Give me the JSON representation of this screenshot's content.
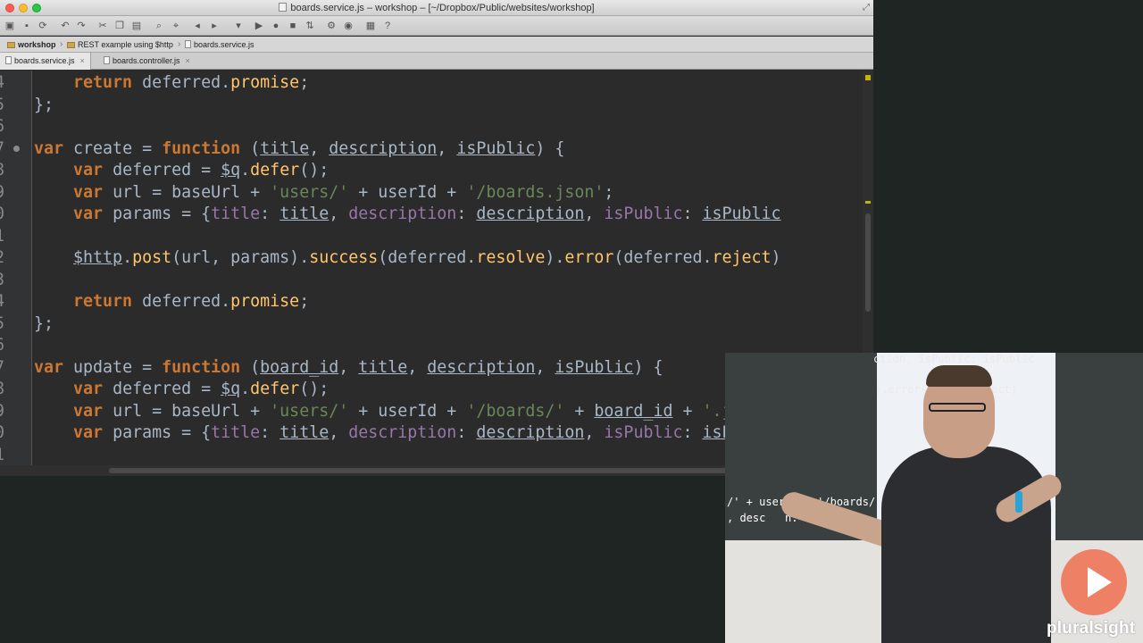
{
  "window": {
    "title": "boards.service.js – workshop – [~/Dropbox/Public/websites/workshop]"
  },
  "navbar": {
    "crumbs": [
      "workshop",
      "REST example using $http",
      "boards.service.js"
    ]
  },
  "tabs": [
    {
      "label": "boards.service.js",
      "active": true
    },
    {
      "label": "boards.controller.js",
      "active": false
    }
  ],
  "editor": {
    "lines": [
      {
        "num": "4"
      },
      {
        "num": "5"
      },
      {
        "num": "6"
      },
      {
        "num": "7"
      },
      {
        "num": "8"
      },
      {
        "num": "9"
      },
      {
        "num": "0"
      },
      {
        "num": "1"
      },
      {
        "num": "2"
      },
      {
        "num": "3"
      },
      {
        "num": "4"
      },
      {
        "num": "5"
      },
      {
        "num": "6"
      },
      {
        "num": "7"
      },
      {
        "num": "8"
      },
      {
        "num": "9"
      },
      {
        "num": "0"
      },
      {
        "num": "1"
      }
    ]
  },
  "video": {
    "proj_lines": [
      "ction, isPublic: isPublic",
      ").error(de     reject)",
      "/' + userId + '/boards/",
      ", desc   n: descr"
    ],
    "brand": "pluralsight"
  }
}
